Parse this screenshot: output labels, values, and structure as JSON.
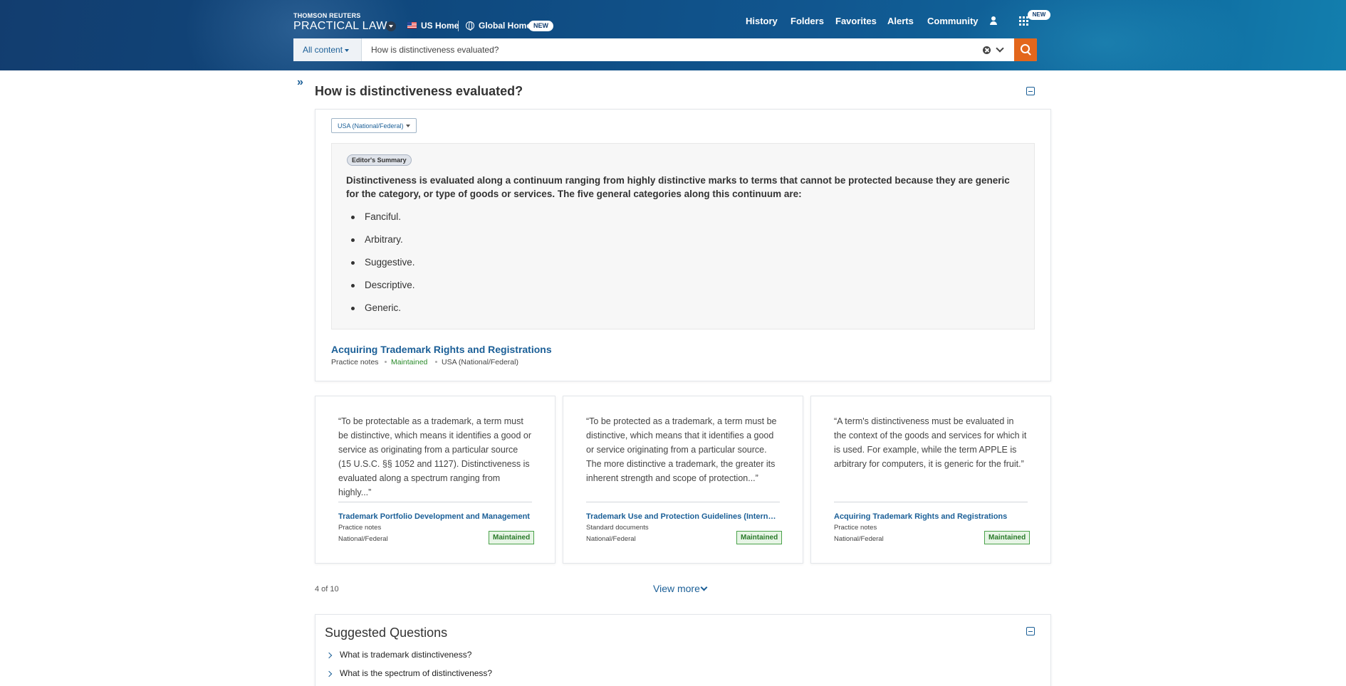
{
  "header": {
    "brand_top": "THOMSON REUTERS",
    "brand_main": "PRACTICAL LAW",
    "us_home": "US Home",
    "global_home": "Global Home",
    "new_badge": "NEW",
    "nav": [
      "History",
      "Folders",
      "Favorites",
      "Alerts",
      "Community"
    ],
    "apps_new_badge": "NEW"
  },
  "search": {
    "scope_label": "All content",
    "query": "How is distinctiveness evaluated?"
  },
  "main": {
    "title": "How is distinctiveness evaluated?",
    "jurisdiction_select": "USA (National/Federal)",
    "editors_summary_badge": "Editor's Summary",
    "summary_text": "Distinctiveness is evaluated along a continuum ranging from highly distinctive marks to terms that cannot be protected because they are generic for the category, or type of goods or services. The five general categories along this continuum are:",
    "categories": [
      "Fanciful.",
      "Arbitrary.",
      "Suggestive.",
      "Descriptive.",
      "Generic."
    ],
    "source": {
      "title": "Acquiring Trademark Rights and Registrations",
      "type": "Practice notes",
      "status": "Maintained",
      "jurisdiction": "USA (National/Federal)"
    }
  },
  "results": [
    {
      "quote": "“To be protectable as a trademark, a term must be distinctive, which means it identifies a good or service as originating from a particular source (15 U.S.C. §§ 1052 and 1127). Distinctiveness is evaluated along a spectrum ranging from highly...”",
      "title": "Trademark Portfolio Development and Management",
      "type": "Practice notes",
      "jurisdiction": "National/Federal",
      "status": "Maintained"
    },
    {
      "quote": "“To be protected as a trademark, a term must be distinctive, which means that it identifies a good or service originating from a particular source. The more distinctive a trademark, the greater its inherent strength and scope of protection...”",
      "title": "Trademark Use and Protection Guidelines (Internal...",
      "type": "Standard documents",
      "jurisdiction": "National/Federal",
      "status": "Maintained"
    },
    {
      "quote": "“A term's distinctiveness must be evaluated in the context of the goods and services for which it is used. For example, while the term APPLE is arbitrary for computers, it is generic for the fruit.”",
      "title": "Acquiring Trademark Rights and Registrations",
      "type": "Practice notes",
      "jurisdiction": "National/Federal",
      "status": "Maintained"
    }
  ],
  "pagination": {
    "counter": "4 of 10",
    "view_more": "View more"
  },
  "suggested": {
    "title": "Suggested Questions",
    "items": [
      "What is trademark distinctiveness?",
      "What is the spectrum of distinctiveness?"
    ]
  },
  "colors": {
    "header_bg": "#123d6f",
    "accent_blue": "#1b5f97",
    "search_button": "#e3661b",
    "maintained_green": "#2a8a2a"
  }
}
